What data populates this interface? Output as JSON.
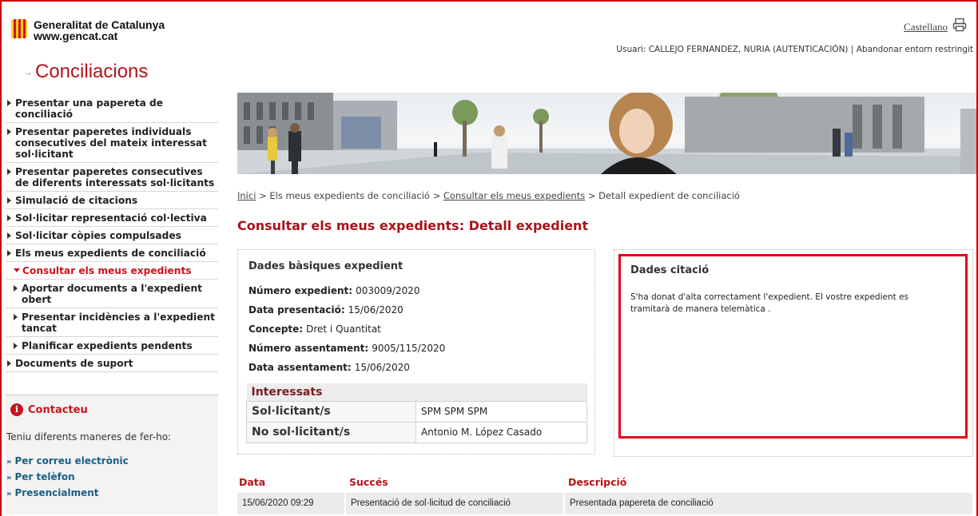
{
  "header": {
    "org_name": "Generalitat de Catalunya",
    "org_url": "www.gencat.cat",
    "language_link": "Castellano",
    "user_line": "Usuari: CALLEJO FERNANDEZ, NURIA (AUTENTICACIÓN) | Abandonar entorn restringit",
    "app_title": "Conciliacions",
    "print_icon": "printer-icon"
  },
  "sidebar": {
    "items": [
      {
        "label": "Presentar una papereta de conciliació"
      },
      {
        "label": "Presentar paperetes individuals consecutives del mateix interessat sol·licitant"
      },
      {
        "label": "Presentar paperetes consecutives de diferents interessats sol·licitants"
      },
      {
        "label": "Simulació de citacions"
      },
      {
        "label": "Sol·licitar representació col·lectiva"
      },
      {
        "label": "Sol·licitar còpies compulsades"
      },
      {
        "label": "Els meus expedients de conciliació"
      },
      {
        "label": "Consultar els meus expedients"
      },
      {
        "label": "Aportar documents a l'expedient obert"
      },
      {
        "label": "Presentar incidències a l'expedient tancat"
      },
      {
        "label": "Planificar expedients pendents"
      },
      {
        "label": "Documents de suport"
      }
    ],
    "contact": {
      "title": "Contacteu",
      "text": "Teniu diferents maneres de fer-ho:",
      "links": [
        "Per correu electrònic",
        "Per telèfon",
        "Presencialment"
      ]
    }
  },
  "breadcrumb": {
    "home": "Inici",
    "sep": ">",
    "step1": "Els meus expedients de conciliació",
    "step2": "Consultar els meus expedients",
    "current": "Detall expedient de conciliació"
  },
  "page_title": "Consultar els meus expedients: Detall expedient",
  "basic": {
    "title": "Dades bàsiques expedient",
    "fields": [
      {
        "label": "Número expedient:",
        "value": "003009/2020"
      },
      {
        "label": "Data presentació:",
        "value": "15/06/2020"
      },
      {
        "label": "Concepte:",
        "value": "Dret i Quantitat"
      },
      {
        "label": "Número assentament:",
        "value": "9005/115/2020"
      },
      {
        "label": "Data assentament:",
        "value": "15/06/2020"
      }
    ],
    "interessats_title": "Interessats",
    "interessats": [
      {
        "label": "Sol·licitant/s",
        "value": "SPM SPM SPM"
      },
      {
        "label": "No sol·licitant/s",
        "value": "Antonio M. López Casado"
      }
    ]
  },
  "citacio": {
    "title": "Dades citació",
    "text": "S'ha donat d'alta correctament l'expedient. El vostre expedient es tramitarà de manera telemàtica ."
  },
  "history": {
    "headers": [
      "Data",
      "Succés",
      "Descripció"
    ],
    "rows": [
      {
        "date": "15/06/2020 09:29",
        "event": "Presentació de sol·licitud de conciliació",
        "description": "Presentada papereta de conciliació"
      }
    ]
  }
}
